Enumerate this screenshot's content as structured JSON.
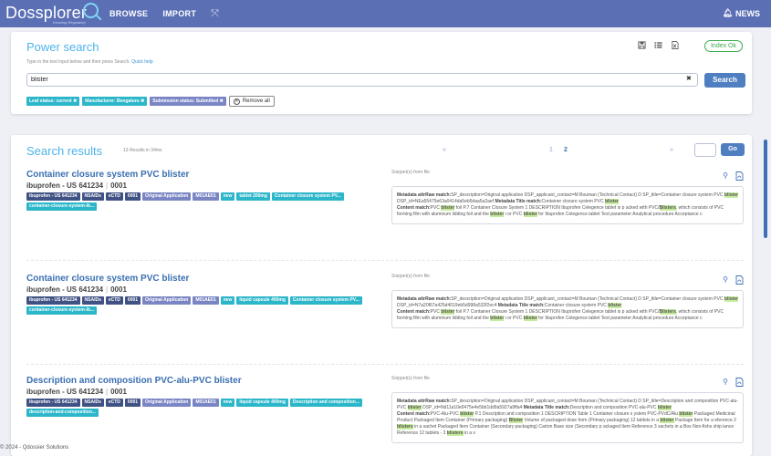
{
  "app": {
    "logo_text": "Dossplorer",
    "logo_tagline": "Knowing Regulatory",
    "nav": [
      "BROWSE",
      "IMPORT"
    ],
    "news_label": "NEWS"
  },
  "power_search": {
    "title": "Power search",
    "help_text": "Type in the text input below and then press Search.",
    "help_link": "Quick help",
    "index_status": "Index Ok",
    "query": "blister",
    "clear_symbol": "✖",
    "search_label": "Search",
    "filters": [
      {
        "label": "Leaf status: current ✖",
        "color": "teal"
      },
      {
        "label": "Manufacturer: Bengaluru ✖",
        "color": "teal"
      },
      {
        "label": "Submission status: Submitted ✖",
        "color": "purple"
      }
    ],
    "remove_all_label": "Remove all"
  },
  "results_header": {
    "title": "Search results",
    "count": "13 Results in 34ms",
    "prev": "«",
    "pages": [
      "1",
      "2"
    ],
    "current_page": "2",
    "next": "»",
    "go_label": "Go"
  },
  "results": [
    {
      "title": "Container closure system PVC blister",
      "product": "ibuprofen - US 641234",
      "sequence": "0001",
      "tags": [
        {
          "label": "ibuprofen - US 641234",
          "color": "dark"
        },
        {
          "label": "NSAIDs",
          "color": "dark"
        },
        {
          "label": "eCTD",
          "color": "dark"
        },
        {
          "label": "0001",
          "color": "dark"
        },
        {
          "label": "Original Application",
          "color": "purple"
        },
        {
          "label": "M01AE01",
          "color": "purple"
        },
        {
          "label": "new",
          "color": "teal"
        },
        {
          "label": "tablet 200mg",
          "color": "teal"
        },
        {
          "label": "Container closure system PV...",
          "color": "teal"
        },
        {
          "label": "container-closure-system-ib...",
          "color": "teal"
        }
      ],
      "snippet_label": "Snippet(s) from file",
      "snippet": [
        "Metadata attrRaw match:SP_description=Original application DSP_applicant_contact=M Bouman (Technical Contact) D SP_title=Container closure system PVC blister DSP_id=NEa55475e63a0414da5eb5daa5a2aef Metadata Title match:Container closure system PVC blister",
        "Content match:PVC blister foil P.7 Container Closure System 1 DESCRIPTION Ibuprofen Celegence tablet is p acked with PVC/Blisters, which consists of PVC forming film with aluminum lidding foil and the blister i or PVC blister for Ibuprofen Celegence tablet Test parameter Analytical procedure Acceptance c"
      ]
    },
    {
      "title": "Container closure system PVC blister",
      "product": "ibuprofen - US 641234",
      "sequence": "0001",
      "tags": [
        {
          "label": "ibuprofen - US 641234",
          "color": "dark"
        },
        {
          "label": "NSAIDs",
          "color": "dark"
        },
        {
          "label": "eCTD",
          "color": "dark"
        },
        {
          "label": "0001",
          "color": "dark"
        },
        {
          "label": "Original Application",
          "color": "purple"
        },
        {
          "label": "M01AE01",
          "color": "purple"
        },
        {
          "label": "new",
          "color": "teal"
        },
        {
          "label": "liquid capsule 400mg",
          "color": "teal"
        },
        {
          "label": "Container closure system PV...",
          "color": "teal"
        },
        {
          "label": "container-closure-system-ib...",
          "color": "teal"
        }
      ],
      "snippet_label": "Snippet(s) from file",
      "snippet": [
        "Metadata attrRaw match:SP_description=Original application DSP_applicant_contact=M Bouman (Technical Contact) D SP_title=Container closure system PVC blister DSP_id=N7a20f67a425d4019eb5d998a532f2ec4 Metadata Title match:Container closure system PVC blister",
        "Content match:PVC blister foil P.7 Container Closure System 1 DESCRIPTION Ibuprofen Celegence tablet is p acked with PVC/Blisters, which consists of PVC forming film with aluminum lidding foil and the blister i or PVC blister for Ibuprofen Celegence tablet Test parameter Analytical procedure Acceptance c"
      ]
    },
    {
      "title": "Description and composition PVC-alu-PVC blister",
      "product": "ibuprofen - US 641234",
      "sequence": "0001",
      "tags": [
        {
          "label": "ibuprofen - US 641234",
          "color": "dark"
        },
        {
          "label": "NSAIDs",
          "color": "dark"
        },
        {
          "label": "eCTD",
          "color": "dark"
        },
        {
          "label": "0001",
          "color": "dark"
        },
        {
          "label": "Original Application",
          "color": "purple"
        },
        {
          "label": "M01AE01",
          "color": "purple"
        },
        {
          "label": "new",
          "color": "teal"
        },
        {
          "label": "liquid capsule 400mg",
          "color": "teal"
        },
        {
          "label": "Description and composition...",
          "color": "teal"
        },
        {
          "label": "description-and-composition...",
          "color": "teal"
        }
      ],
      "snippet_label": "Snippet(s) from file",
      "snippet": [
        "Metadata attrRaw match:SP_description=Original application DSP_applicant_contact=M Bouman (Technical Contact) D SP_title=Description and composition PVC-alu-PVC blister DSP_id=Nd11a10e0475e4e5bb1dd9a5927a9ffa4 Metadata Title match:Description and composition PVC-alu-PVC blister",
        "Content match:PVC-Alu-PVC blister P.1 Description and composition 1 DESCRIPTION Table 1 Container closure s ystem PVC-PVdC/Alu blister Packaged Medicinal Product Packaged Item Container (Primary packaging) Blister Volume of packaged dose form (Primary packaging) 12 tablets in a blister Package Item for a eference 2 blisters in a sachet Packaged Item Container (Secondary packaging) Carton Base size (Secondary p ackaged Item Reference 3 sachets in a Box Non-fishs ship iance Reference 12 tablets - 3 blisters in a s"
      ]
    }
  ],
  "footer": "© 2024 - Qdossier Solutions",
  "colors": {
    "topbar": "#5b6fb5",
    "accent_title": "#4fb3e8",
    "link": "#3a6fb2",
    "button": "#4f7fc1",
    "ok_green": "#3aaa4e",
    "tag_dark": "#405184",
    "tag_purple": "#7a86c4",
    "tag_teal": "#2bb6c9",
    "highlight": "#c8ec9e"
  },
  "icons": [
    "bell-icon",
    "save-icon",
    "list-icon",
    "excel-icon",
    "location-pin-icon",
    "pdf-icon",
    "remove-circle-icon",
    "expand-icon"
  ]
}
